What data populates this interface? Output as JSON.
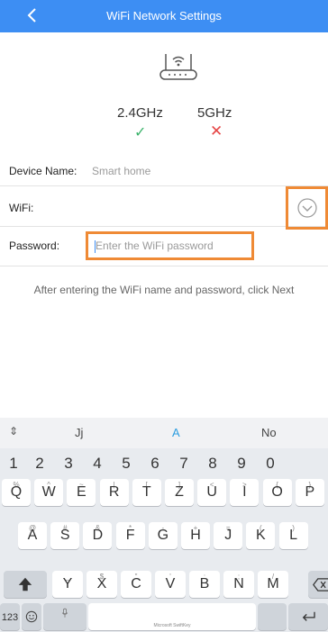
{
  "header": {
    "title": "WiFi Network Settings"
  },
  "bands": {
    "band_24": "2.4GHz",
    "band_5": "5GHz",
    "band_24_mark": "✓",
    "band_5_mark": "✕",
    "ok_color": "#3bb36b",
    "error_color": "#e64646"
  },
  "form": {
    "device_label": "Device Name:",
    "device_value": "Smart home",
    "wifi_label": "WiFi:",
    "wifi_value": "",
    "password_label": "Password:",
    "password_placeholder": "Enter the WiFi password",
    "password_value": ""
  },
  "hint": "After entering the WiFi name and password, click Next",
  "colors": {
    "header": "#3d8ef3",
    "highlight": "#ef8a35"
  },
  "keyboard": {
    "suggestions": [
      "Jj",
      "A",
      "No"
    ],
    "numbers": [
      "1",
      "2",
      "3",
      "4",
      "5",
      "6",
      "7",
      "8",
      "9",
      "0"
    ],
    "row1": [
      {
        "main": "Q",
        "sub": "%"
      },
      {
        "main": "W",
        "sub": "^"
      },
      {
        "main": "E",
        "sub": "~"
      },
      {
        "main": "R",
        "sub": "|"
      },
      {
        "main": "T",
        "sub": "["
      },
      {
        "main": "Z",
        "sub": "]"
      },
      {
        "main": "U",
        "sub": "<"
      },
      {
        "main": "I",
        "sub": ">"
      },
      {
        "main": "O",
        "sub": "{"
      },
      {
        "main": "P",
        "sub": "}"
      }
    ],
    "row2": [
      {
        "main": "A",
        "sub": "@"
      },
      {
        "main": "S",
        "sub": "#"
      },
      {
        "main": "D",
        "sub": "&"
      },
      {
        "main": "F",
        "sub": "*"
      },
      {
        "main": "G",
        "sub": "-"
      },
      {
        "main": "H",
        "sub": "+"
      },
      {
        "main": "J",
        "sub": "="
      },
      {
        "main": "K",
        "sub": "("
      },
      {
        "main": "L",
        "sub": ")"
      }
    ],
    "row3": [
      {
        "main": "Y",
        "sub": "_"
      },
      {
        "main": "X",
        "sub": "$"
      },
      {
        "main": "C",
        "sub": "\""
      },
      {
        "main": "V",
        "sub": "'"
      },
      {
        "main": "B",
        "sub": ":"
      },
      {
        "main": "N",
        "sub": ";"
      },
      {
        "main": "M",
        "sub": "/"
      }
    ],
    "mode_key": "123",
    "space_brand": "Microsoft SwiftKey",
    "icons": {
      "shift": "shift-icon",
      "backspace": "backspace-icon",
      "emoji": "emoji-icon",
      "mic": "mic-icon",
      "enter": "enter-icon",
      "expand": "expand-icon"
    }
  }
}
